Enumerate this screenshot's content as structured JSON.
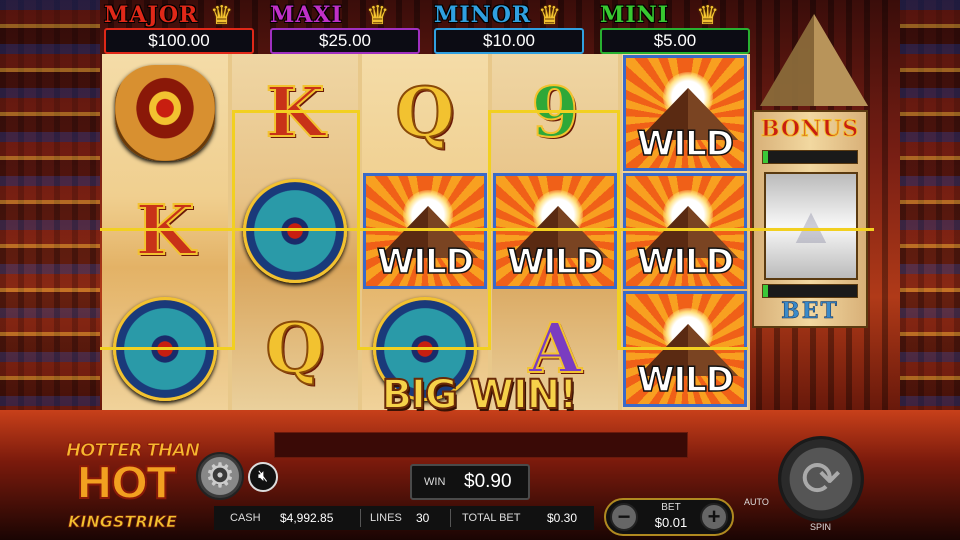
{
  "jackpots": [
    {
      "label": "MAJOR",
      "value": "$100.00",
      "color": "#e02818",
      "box_color": "#e02818"
    },
    {
      "label": "MAXI",
      "value": "$25.00",
      "color": "#c030c8",
      "box_color": "#a030c0"
    },
    {
      "label": "MINOR",
      "value": "$10.00",
      "color": "#30a0e0",
      "box_color": "#30a0e0"
    },
    {
      "label": "MINI",
      "value": "$5.00",
      "color": "#38c830",
      "box_color": "#28b030"
    }
  ],
  "reels": [
    [
      "eye-of-horus",
      "K",
      "scarab-disc"
    ],
    [
      "K",
      "scarab-disc",
      "Q"
    ],
    [
      "Q",
      "WILD",
      "scarab-disc"
    ],
    [
      "9",
      "WILD",
      "A"
    ],
    [
      "WILD",
      "WILD",
      "WILD"
    ]
  ],
  "symbols": {
    "wild_text": "WILD"
  },
  "banner": "BIG WIN!",
  "bonus": {
    "title": "BONUS",
    "bet_label": "BET",
    "top_meter_fill": 0.05,
    "bottom_meter_fill": 0.05
  },
  "game_logo": {
    "line1": "HOTTER THAN",
    "line2": "HOT",
    "line3": "KINGSTRIKE"
  },
  "win": {
    "label": "WIN",
    "value": "$0.90"
  },
  "status": {
    "cash_label": "CASH",
    "cash_value": "$4,992.85",
    "lines_label": "LINES",
    "lines_value": "30",
    "total_bet_label": "TOTAL BET",
    "total_bet_value": "$0.30"
  },
  "bet": {
    "label": "BET",
    "value": "$0.01",
    "minus": "−",
    "plus": "+"
  },
  "auto_label": "AUTO",
  "spin_label": "SPIN",
  "icons": {
    "settings": "gear-icon",
    "sound": "sound-muted-icon",
    "spin": "spin-arrows-icon"
  }
}
